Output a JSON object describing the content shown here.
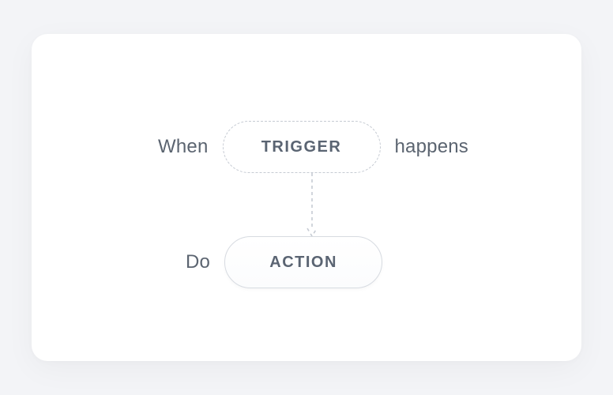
{
  "workflow": {
    "trigger_prefix": "When",
    "trigger_label": "TRIGGER",
    "trigger_suffix": "happens",
    "action_prefix": "Do",
    "action_label": "ACTION"
  }
}
